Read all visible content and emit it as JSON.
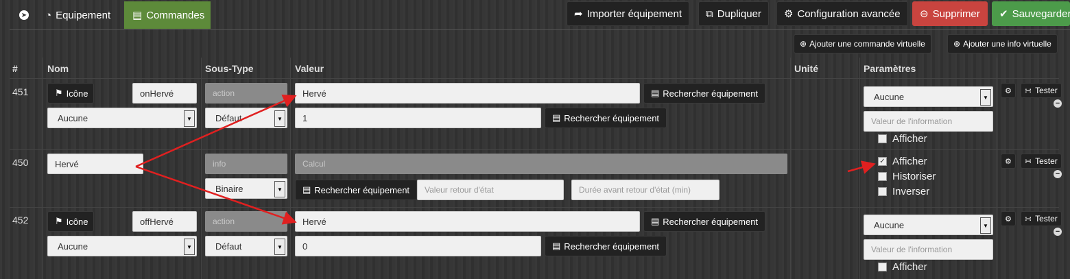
{
  "tabs": {
    "back_icon": "circle-arrow-left-icon",
    "equipment": "Equipement",
    "commands": "Commandes"
  },
  "toolbar": {
    "import": "Importer équipement",
    "duplicate": "Dupliquer",
    "advanced_config": "Configuration avancée",
    "delete": "Supprimer",
    "save": "Sauvegarder"
  },
  "actions": {
    "add_virtual_command": "Ajouter une commande virtuelle",
    "add_virtual_info": "Ajouter une info virtuelle"
  },
  "columns": {
    "id": "#",
    "name": "Nom",
    "subtype": "Sous-Type",
    "value": "Valeur",
    "unit": "Unité",
    "params": "Paramètres"
  },
  "common": {
    "icon_button": "Icône",
    "search_equipment": "Rechercher équipement",
    "test": "Tester",
    "info_value_placeholder": "Valeur de l'information",
    "display": "Afficher",
    "historize": "Historiser",
    "invert": "Inverser"
  },
  "rows": [
    {
      "id": "451",
      "name": "onHervé",
      "type": "action",
      "subtype": "Défaut",
      "value_info": "Hervé",
      "value": "1",
      "info_select": "Aucune",
      "param_select": "Aucune"
    },
    {
      "id": "450",
      "name": "Hervé",
      "type": "info",
      "subtype": "Binaire",
      "calc_placeholder": "Calcul",
      "return_state_placeholder": "Valeur retour d'état",
      "return_delay_placeholder": "Durée avant retour d'état (min)",
      "display_checked": true,
      "historize_checked": false,
      "invert_checked": false
    },
    {
      "id": "452",
      "name": "offHervé",
      "type": "action",
      "subtype": "Défaut",
      "value_info": "Hervé",
      "value": "0",
      "info_select": "Aucune",
      "param_select": "Aucune"
    }
  ],
  "colors": {
    "accent_green": "#5d8a3a",
    "danger": "#c9443f",
    "success": "#4c9b4a",
    "annotation_arrow": "#e02020"
  }
}
